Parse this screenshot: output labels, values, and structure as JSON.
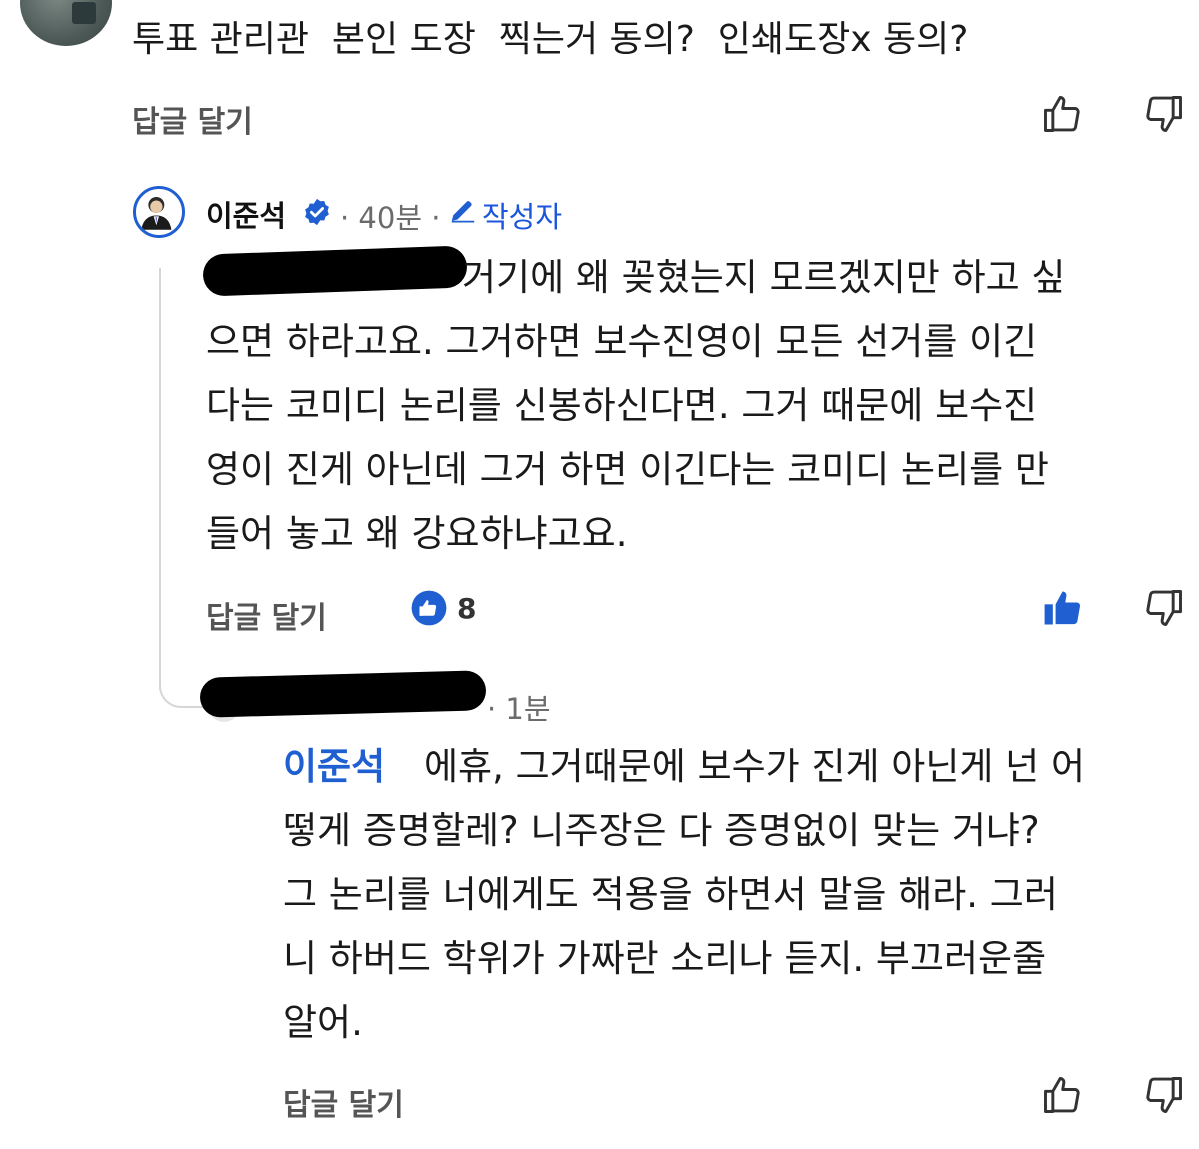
{
  "top_comment": {
    "text": "투표 관리관  본인 도장  찍는거 동의?  인쇄도장x 동의?",
    "reply_label": "답글 달기"
  },
  "author_reply": {
    "name": "이준석",
    "time": "· 40분 ·",
    "author_badge": "작성자",
    "lines": [
      "거기에 왜 꽂혔는지 모르겠지만 하고 싶",
      "으면 하라고요. 그거하면 보수진영이 모든 선거를 이긴",
      "다는 코미디 논리를 신봉하신다면. 그거 때문에 보수진",
      "영이 진게 아닌데 그거 하면 이긴다는 코미디 논리를 만",
      "들어 놓고 왜 강요하냐고요."
    ],
    "reply_label": "답글 달기",
    "like_count": "8"
  },
  "nested_reply": {
    "time": "· 1분",
    "mention": "이준석",
    "lines": [
      "에휴, 그거때문에 보수가 진게 아닌게 넌 어",
      "떻게 증명할레? 니주장은 다 증명없이 맞는 거냐?",
      "그 논리를 너에게도 적용을 하면서 말을 해라. 그러",
      "니 하버드 학위가 가짜란 소리나 듣지. 부끄러운줄",
      "알어."
    ],
    "reply_label": "답글 달기"
  },
  "icons": {
    "like": "thumbs-up-icon",
    "dislike": "thumbs-down-icon",
    "verified": "verified-badge-icon",
    "pencil": "pencil-icon"
  },
  "colors": {
    "accent": "#1f5fd1",
    "gray_text": "#6b6b6b"
  }
}
